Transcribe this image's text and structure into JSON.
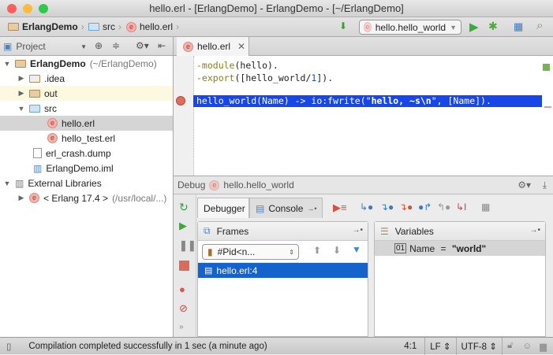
{
  "window": {
    "title": "hello.erl - [ErlangDemo] - ErlangDemo - [~/ErlangDemo]"
  },
  "navbar": {
    "breadcrumbs": [
      "ErlangDemo",
      "src",
      "hello.erl"
    ],
    "run_config": "hello.hello_world"
  },
  "project_panel": {
    "title": "Project"
  },
  "editor_tabs": [
    {
      "label": "hello.erl"
    }
  ],
  "tree": [
    {
      "label": "ErlangDemo",
      "suffix": "(~/ErlangDemo)"
    },
    {
      "label": ".idea"
    },
    {
      "label": "out"
    },
    {
      "label": "src"
    },
    {
      "label": "hello.erl"
    },
    {
      "label": "hello_test.erl"
    },
    {
      "label": "erl_crash.dump"
    },
    {
      "label": "ErlangDemo.iml"
    },
    {
      "label": "External Libraries"
    },
    {
      "label": "< Erlang 17.4 >",
      "suffix": "(/usr/local/...)"
    }
  ],
  "code": {
    "line1a": "-module",
    "line1b": "(hello).",
    "line2a": "-export",
    "line2b": "([hello_world/",
    "line2n": "1",
    "line2c": "]).",
    "line4a": "hello_world(Name) -> io:fwrite(\"",
    "line4b": "hello, ~s\\n",
    "line4c": "\", [Name])."
  },
  "debug": {
    "label": "Debug",
    "config": "hello.hello_world",
    "tabs": [
      "Debugger",
      "Console"
    ],
    "frames": {
      "title": "Frames",
      "thread": "#Pid<n...",
      "items": [
        "hello.erl:4"
      ]
    },
    "variables": {
      "title": "Variables",
      "items": [
        {
          "name": "Name",
          "eq": " = ",
          "value": "\"world\""
        }
      ]
    }
  },
  "status": {
    "message": "Compilation completed successfully in 1 sec (a minute ago)",
    "position": "4:1",
    "line_sep": "LF",
    "encoding": "UTF-8"
  }
}
